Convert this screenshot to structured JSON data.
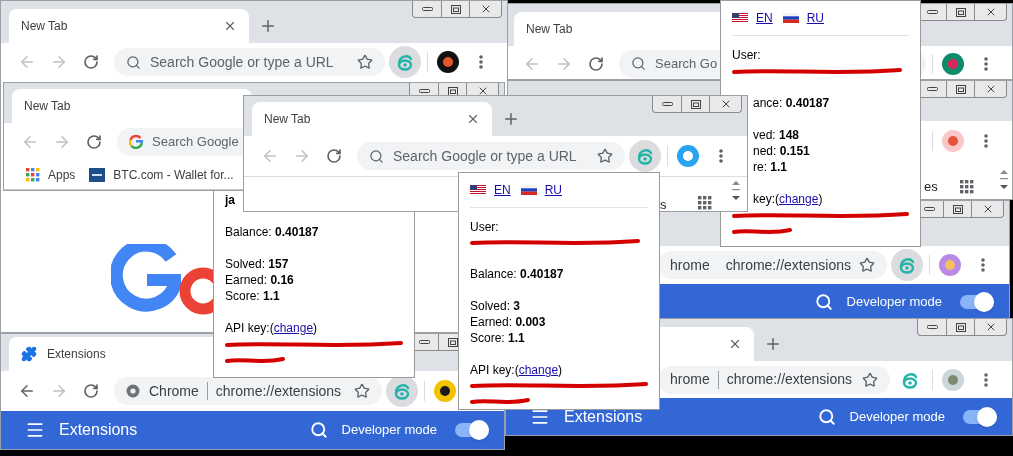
{
  "windows": [
    {
      "kind": "browser",
      "tab": "New Tab",
      "back_disabled": true,
      "forward_disabled": true,
      "search_placeholder": "Search Google or type a URL",
      "extension_highlighted": true
    },
    {
      "kind": "browser",
      "tab": "New Tab",
      "back_disabled": true,
      "forward_disabled": true,
      "search_placeholder": "Search Go"
    },
    {
      "kind": "popup",
      "languages": [
        "EN",
        "RU"
      ],
      "user": {
        "label": "User:"
      },
      "balance": "ance: **0.40187**",
      "stats": [
        "ved: **148**",
        "ned: **0.151**",
        "re: **1.1**"
      ],
      "api_key": {
        "label": "key:(",
        "link": "change",
        "suffix": ")"
      }
    },
    {
      "kind": "browser",
      "ntp_links": [
        "es"
      ]
    },
    {
      "kind": "browser",
      "tab": "New Tab",
      "back_disabled": true,
      "forward_disabled": true,
      "search_placeholder": "Search Google",
      "bookmarks": [
        "Apps",
        "BTC.com - Wallet for..."
      ]
    },
    {
      "kind": "browser",
      "tab": "New Tab",
      "back_disabled": true,
      "forward_disabled": true,
      "search_placeholder": "Search Google or type a URL",
      "extension_highlighted": true,
      "ntp_links": [
        "s"
      ]
    },
    {
      "kind": "popup",
      "user": {
        "value": "ja"
      },
      "balance": "Balance: **0.40187**",
      "stats": [
        "Solved: **157**",
        "Earned: **0.16**",
        "Score: **1.1**"
      ],
      "api_key": {
        "label": "API key:(",
        "link": "change",
        "suffix": ")"
      }
    },
    {
      "kind": "popup",
      "languages": [
        "EN",
        "RU"
      ],
      "user": {
        "label": "User:"
      },
      "balance": "Balance: **0.40187**",
      "stats": [
        "Solved: **3**",
        "Earned: **0.003**",
        "Score: **1.1**"
      ],
      "api_key": {
        "label": "API key:(",
        "link": "change",
        "suffix": ")"
      }
    },
    {
      "kind": "browser",
      "omnibox_site": "hrome",
      "omnibox_url": "chrome://extensions",
      "extension_highlighted": true,
      "header": {
        "developer_mode": {
          "label": "Developer mode",
          "on": true
        }
      }
    },
    {
      "kind": "browser",
      "tab": "Extensions",
      "back_disabled": false,
      "forward_disabled": true,
      "omnibox_site": "Chrome",
      "omnibox_url": "chrome://extensions",
      "extension_highlighted": true,
      "header": {
        "title": "Extensions",
        "developer_mode": {
          "label": "Developer mode",
          "on": true
        }
      }
    },
    {
      "kind": "browser",
      "omnibox_site": "hrome",
      "omnibox_url": "chrome://extensions",
      "extension_highlighted": false,
      "header": {
        "title": "Extensions",
        "developer_mode": {
          "label": "Developer mode",
          "on": true
        }
      }
    }
  ]
}
